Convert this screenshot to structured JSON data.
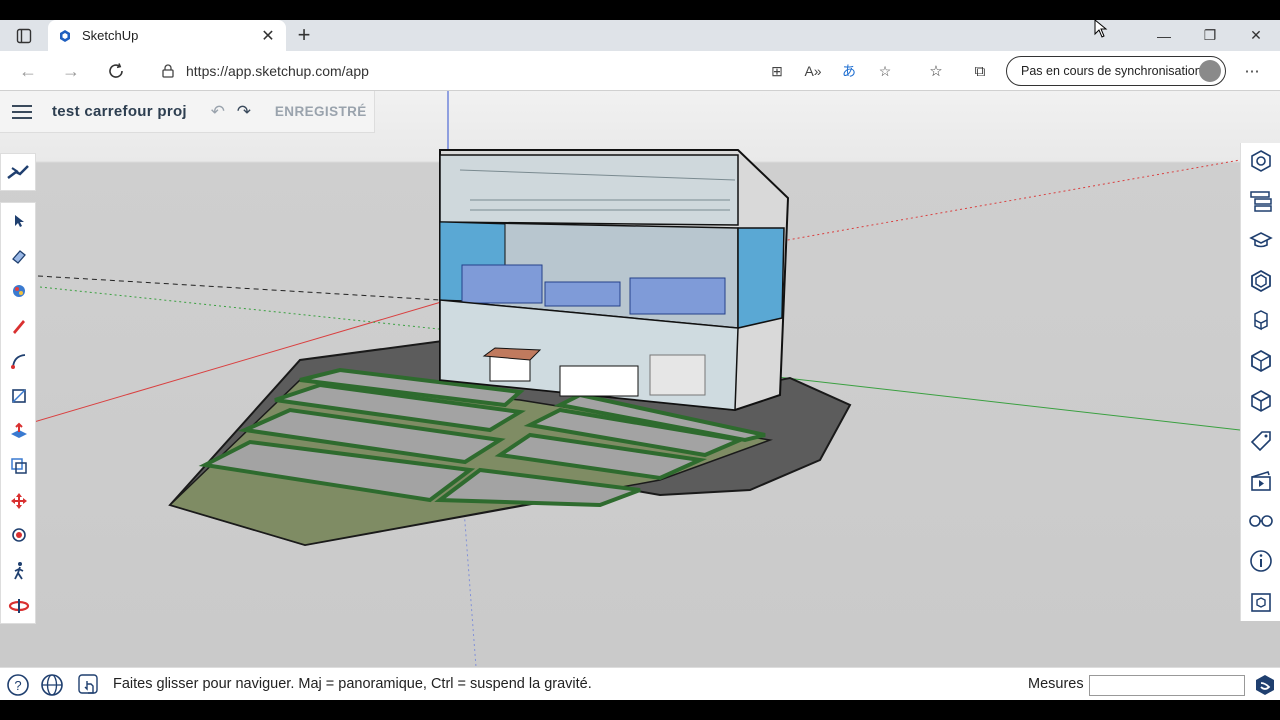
{
  "browser": {
    "tab_title": "SketchUp",
    "url": "https://app.sketchup.com/app",
    "sync_label": "Pas en cours de synchronisation"
  },
  "app": {
    "project_name": "test carrefour proj",
    "save_status": "ENREGISTRÉ",
    "status_hint": "Faites glisser pour naviguer. Maj = panoramique, Ctrl = suspend la gravité.",
    "measurements_label": "Mesures",
    "measurements_value": ""
  },
  "left_tools": [
    "search-tool-icon",
    "select-icon",
    "eraser-icon",
    "paint-bucket-icon",
    "pencil-icon",
    "arc-icon",
    "rectangle-icon",
    "push-pull-icon",
    "offset-icon",
    "move-icon",
    "position-camera-icon",
    "walk-icon",
    "orbit-icon"
  ],
  "right_panels": [
    "entity-info-icon",
    "outliner-icon",
    "instructor-icon",
    "components-icon",
    "materials-icon",
    "3d-warehouse-icon",
    "solid-inspector-icon",
    "tags-icon",
    "scenes-icon",
    "display-icon",
    "model-info-icon",
    "extension-warehouse-icon"
  ],
  "colors": {
    "accent": "#1f6fd1",
    "red_axis": "#d94040",
    "green_axis": "#3aa040",
    "blue_axis": "#3050d0",
    "grass": "#2e6b2e"
  }
}
